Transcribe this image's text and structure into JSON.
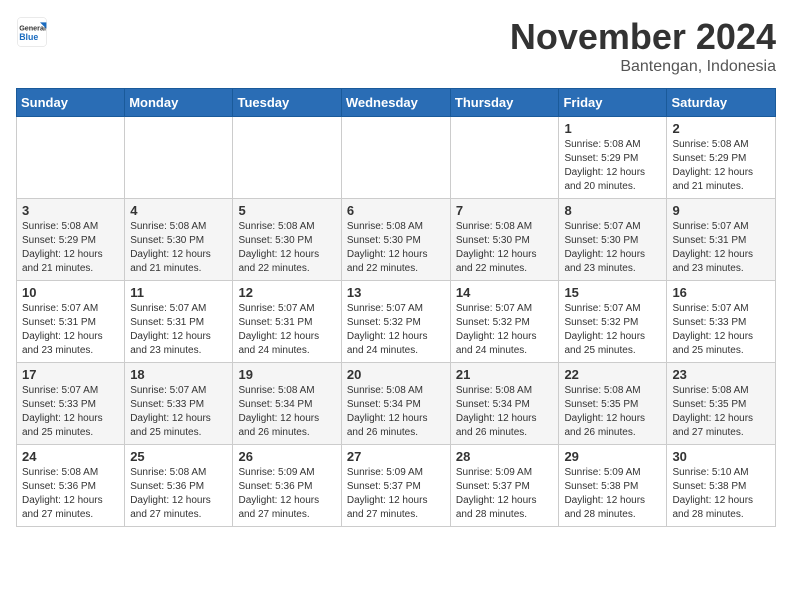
{
  "header": {
    "logo": {
      "line1": "General",
      "line2": "Blue"
    },
    "month": "November 2024",
    "location": "Bantengan, Indonesia"
  },
  "weekdays": [
    "Sunday",
    "Monday",
    "Tuesday",
    "Wednesday",
    "Thursday",
    "Friday",
    "Saturday"
  ],
  "weeks": [
    [
      {
        "day": "",
        "info": ""
      },
      {
        "day": "",
        "info": ""
      },
      {
        "day": "",
        "info": ""
      },
      {
        "day": "",
        "info": ""
      },
      {
        "day": "",
        "info": ""
      },
      {
        "day": "1",
        "info": "Sunrise: 5:08 AM\nSunset: 5:29 PM\nDaylight: 12 hours\nand 20 minutes."
      },
      {
        "day": "2",
        "info": "Sunrise: 5:08 AM\nSunset: 5:29 PM\nDaylight: 12 hours\nand 21 minutes."
      }
    ],
    [
      {
        "day": "3",
        "info": "Sunrise: 5:08 AM\nSunset: 5:29 PM\nDaylight: 12 hours\nand 21 minutes."
      },
      {
        "day": "4",
        "info": "Sunrise: 5:08 AM\nSunset: 5:30 PM\nDaylight: 12 hours\nand 21 minutes."
      },
      {
        "day": "5",
        "info": "Sunrise: 5:08 AM\nSunset: 5:30 PM\nDaylight: 12 hours\nand 22 minutes."
      },
      {
        "day": "6",
        "info": "Sunrise: 5:08 AM\nSunset: 5:30 PM\nDaylight: 12 hours\nand 22 minutes."
      },
      {
        "day": "7",
        "info": "Sunrise: 5:08 AM\nSunset: 5:30 PM\nDaylight: 12 hours\nand 22 minutes."
      },
      {
        "day": "8",
        "info": "Sunrise: 5:07 AM\nSunset: 5:30 PM\nDaylight: 12 hours\nand 23 minutes."
      },
      {
        "day": "9",
        "info": "Sunrise: 5:07 AM\nSunset: 5:31 PM\nDaylight: 12 hours\nand 23 minutes."
      }
    ],
    [
      {
        "day": "10",
        "info": "Sunrise: 5:07 AM\nSunset: 5:31 PM\nDaylight: 12 hours\nand 23 minutes."
      },
      {
        "day": "11",
        "info": "Sunrise: 5:07 AM\nSunset: 5:31 PM\nDaylight: 12 hours\nand 23 minutes."
      },
      {
        "day": "12",
        "info": "Sunrise: 5:07 AM\nSunset: 5:31 PM\nDaylight: 12 hours\nand 24 minutes."
      },
      {
        "day": "13",
        "info": "Sunrise: 5:07 AM\nSunset: 5:32 PM\nDaylight: 12 hours\nand 24 minutes."
      },
      {
        "day": "14",
        "info": "Sunrise: 5:07 AM\nSunset: 5:32 PM\nDaylight: 12 hours\nand 24 minutes."
      },
      {
        "day": "15",
        "info": "Sunrise: 5:07 AM\nSunset: 5:32 PM\nDaylight: 12 hours\nand 25 minutes."
      },
      {
        "day": "16",
        "info": "Sunrise: 5:07 AM\nSunset: 5:33 PM\nDaylight: 12 hours\nand 25 minutes."
      }
    ],
    [
      {
        "day": "17",
        "info": "Sunrise: 5:07 AM\nSunset: 5:33 PM\nDaylight: 12 hours\nand 25 minutes."
      },
      {
        "day": "18",
        "info": "Sunrise: 5:07 AM\nSunset: 5:33 PM\nDaylight: 12 hours\nand 25 minutes."
      },
      {
        "day": "19",
        "info": "Sunrise: 5:08 AM\nSunset: 5:34 PM\nDaylight: 12 hours\nand 26 minutes."
      },
      {
        "day": "20",
        "info": "Sunrise: 5:08 AM\nSunset: 5:34 PM\nDaylight: 12 hours\nand 26 minutes."
      },
      {
        "day": "21",
        "info": "Sunrise: 5:08 AM\nSunset: 5:34 PM\nDaylight: 12 hours\nand 26 minutes."
      },
      {
        "day": "22",
        "info": "Sunrise: 5:08 AM\nSunset: 5:35 PM\nDaylight: 12 hours\nand 26 minutes."
      },
      {
        "day": "23",
        "info": "Sunrise: 5:08 AM\nSunset: 5:35 PM\nDaylight: 12 hours\nand 27 minutes."
      }
    ],
    [
      {
        "day": "24",
        "info": "Sunrise: 5:08 AM\nSunset: 5:36 PM\nDaylight: 12 hours\nand 27 minutes."
      },
      {
        "day": "25",
        "info": "Sunrise: 5:08 AM\nSunset: 5:36 PM\nDaylight: 12 hours\nand 27 minutes."
      },
      {
        "day": "26",
        "info": "Sunrise: 5:09 AM\nSunset: 5:36 PM\nDaylight: 12 hours\nand 27 minutes."
      },
      {
        "day": "27",
        "info": "Sunrise: 5:09 AM\nSunset: 5:37 PM\nDaylight: 12 hours\nand 27 minutes."
      },
      {
        "day": "28",
        "info": "Sunrise: 5:09 AM\nSunset: 5:37 PM\nDaylight: 12 hours\nand 28 minutes."
      },
      {
        "day": "29",
        "info": "Sunrise: 5:09 AM\nSunset: 5:38 PM\nDaylight: 12 hours\nand 28 minutes."
      },
      {
        "day": "30",
        "info": "Sunrise: 5:10 AM\nSunset: 5:38 PM\nDaylight: 12 hours\nand 28 minutes."
      }
    ]
  ]
}
